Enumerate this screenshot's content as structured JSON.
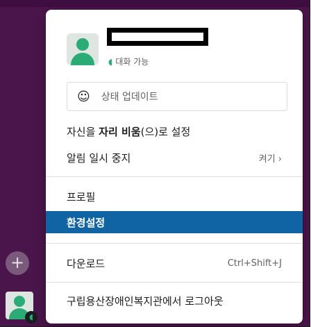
{
  "user": {
    "presence_label": "대화 가능"
  },
  "status": {
    "placeholder": "상태 업데이트"
  },
  "menu": {
    "away_prefix": "자신을 ",
    "away_bold": "자리 비움",
    "away_suffix": "(으)로 설정",
    "pause": {
      "label": "알림 일시 중지",
      "hint": "켜기 ›"
    },
    "profile": "프로필",
    "preferences": "환경설정",
    "download": {
      "label": "다운로드",
      "hint": "Ctrl+Shift+J"
    },
    "signout": "구립용산장애인복지관에서 로그아웃"
  },
  "sidebar": {
    "add_label": "+"
  },
  "colors": {
    "workspace_bg": "#4a154b",
    "selected_bg": "#1164a3",
    "presence_green": "#2bac76"
  }
}
